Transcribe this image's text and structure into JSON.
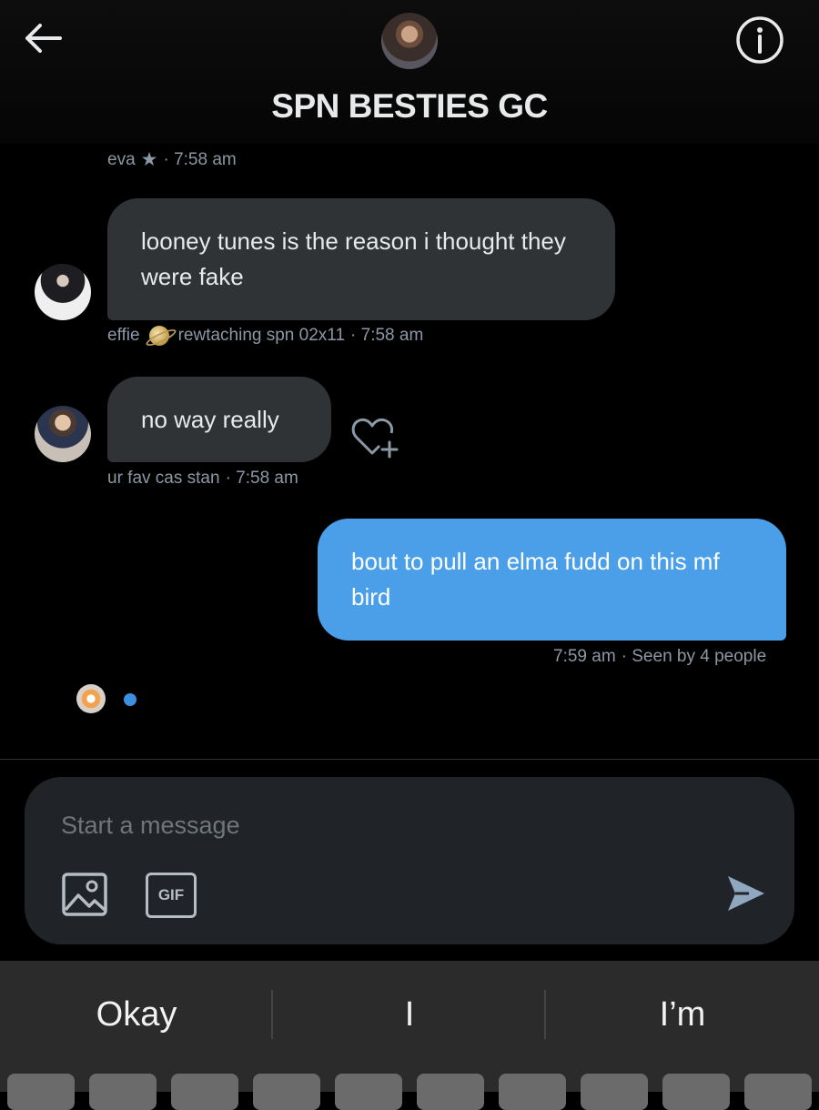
{
  "header": {
    "title": "SPN BESTIES GC",
    "back_icon": "arrow-left-icon",
    "info_icon": "info-icon"
  },
  "messages": [
    {
      "meta_name": "eva",
      "meta_badge_icon": "star-icon",
      "meta_time": "· 7:58 am"
    },
    {
      "text": "looney tunes is the reason i thought they were fake",
      "author": "effie",
      "status": "rewtaching spn 02x11",
      "time": "· 7:58 am"
    },
    {
      "text": "no way really",
      "author": "ur fav cas stan",
      "time": "· 7:58 am"
    },
    {
      "text": "bout to pull an elma fudd on this mf bird",
      "time": "7:59 am",
      "seen": "· Seen by 4 people"
    }
  ],
  "composer": {
    "placeholder": "Start a message",
    "gif_label": "GIF"
  },
  "keyboard": {
    "suggestions": [
      "Okay",
      "I",
      "I’m"
    ]
  },
  "colors": {
    "my_bubble": "#4a9fe8",
    "their_bubble": "#2f3336",
    "background": "#000000"
  }
}
